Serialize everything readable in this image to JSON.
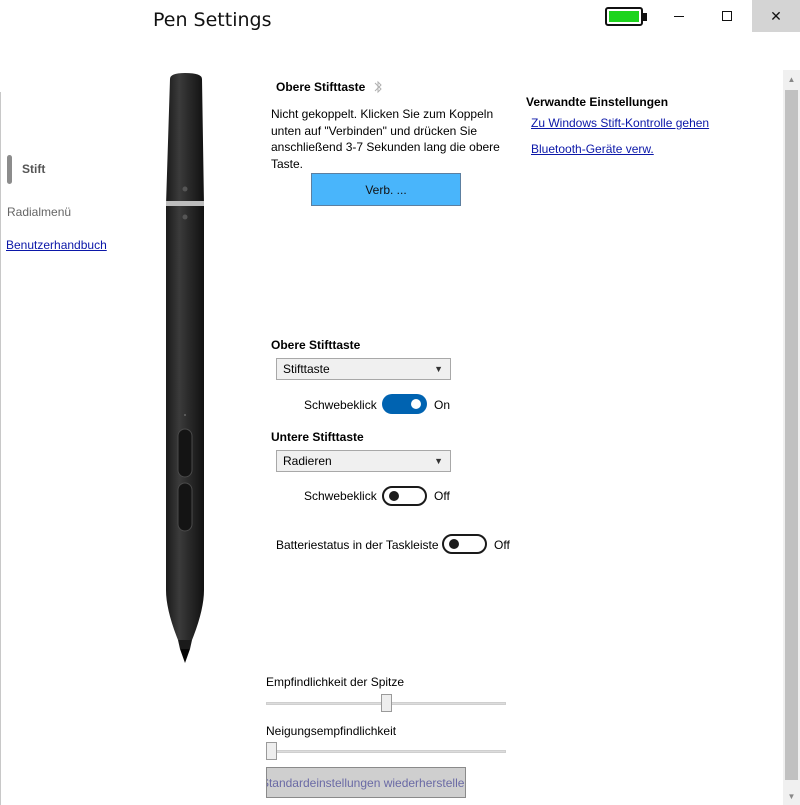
{
  "window": {
    "title": "Pen Settings",
    "battery_level": 1.0,
    "battery_color": "#1cd41c",
    "close_glyph": "✕"
  },
  "nav": {
    "items": [
      {
        "label": "Stift",
        "active": true
      },
      {
        "label": "Radialmenü",
        "active": false
      },
      {
        "label": "Benutzerhandbuch",
        "link": true
      }
    ]
  },
  "pairing": {
    "heading": "Obere Stifttaste",
    "icon": "bluetooth-icon",
    "description": "Nicht gekoppelt. Klicken Sie zum Koppeln unten auf \"Verbinden\" und drücken Sie anschließend 3-7 Sekunden lang die obere Taste.",
    "connect_label": "Verb. ..."
  },
  "related": {
    "heading": "Verwandte Einstellungen",
    "links": [
      "Zu Windows Stift-Kontrolle gehen",
      "Bluetooth-Geräte verw."
    ]
  },
  "top_button": {
    "heading": "Obere Stifttaste",
    "selected": "Stifttaste",
    "hover_label": "Schwebeklick",
    "hover_state": "On",
    "hover_on": true
  },
  "bottom_button": {
    "heading": "Untere Stifttaste",
    "selected": "Radieren",
    "hover_label": "Schwebeklick",
    "hover_state": "Off",
    "hover_on": false
  },
  "battery_taskbar": {
    "label": "Batteriestatus in der Taskleiste",
    "state": "Off",
    "on": false
  },
  "sliders": {
    "tip_sensitivity": {
      "label": "Empfindlichkeit der Spitze",
      "value": 0.5
    },
    "tilt_sensitivity": {
      "label": "Neigungsempfindlichkeit",
      "value": 0.0
    }
  },
  "reset_label": "Standardeinstellungen wiederherstellen",
  "colors": {
    "accent": "#0063b1",
    "connect_button": "#49b5fb",
    "link": "#0b17a8"
  }
}
